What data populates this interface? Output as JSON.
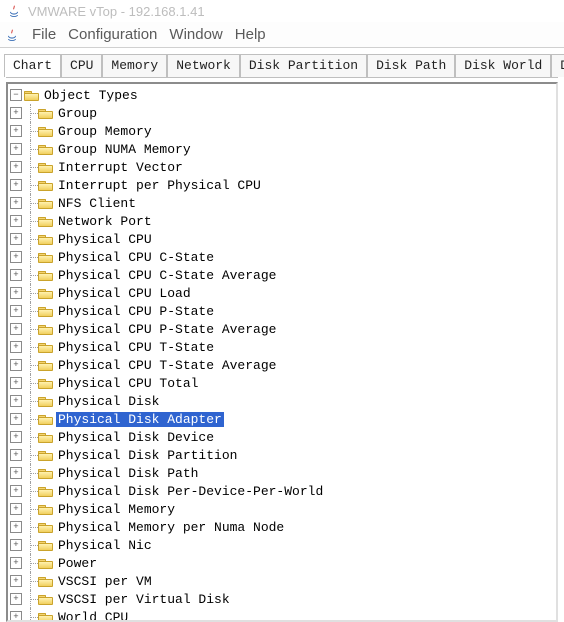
{
  "window": {
    "title": "VMWARE vTop - 192.168.1.41"
  },
  "menu": {
    "items": [
      "File",
      "Configuration",
      "Window",
      "Help"
    ]
  },
  "tabs": {
    "items": [
      "Chart",
      "CPU",
      "Memory",
      "Network",
      "Disk Partition",
      "Disk Path",
      "Disk World",
      "Disk "
    ],
    "active_index": 0
  },
  "tree": {
    "root": "Object Types",
    "selected": "Physical Disk Adapter",
    "items": [
      "Group",
      "Group Memory",
      "Group NUMA Memory",
      "Interrupt Vector",
      "Interrupt per Physical CPU",
      "NFS Client",
      "Network Port",
      "Physical CPU",
      "Physical CPU C-State",
      "Physical CPU C-State Average",
      "Physical CPU Load",
      "Physical CPU P-State",
      "Physical CPU P-State Average",
      "Physical CPU T-State",
      "Physical CPU T-State Average",
      "Physical CPU Total",
      "Physical Disk",
      "Physical Disk Adapter",
      "Physical Disk Device",
      "Physical Disk Partition",
      "Physical Disk Path",
      "Physical Disk Per-Device-Per-World",
      "Physical Memory",
      "Physical Memory per Numa Node",
      "Physical Nic",
      "Power",
      "VSCSI per VM",
      "VSCSI per Virtual Disk",
      "World CPU"
    ]
  }
}
